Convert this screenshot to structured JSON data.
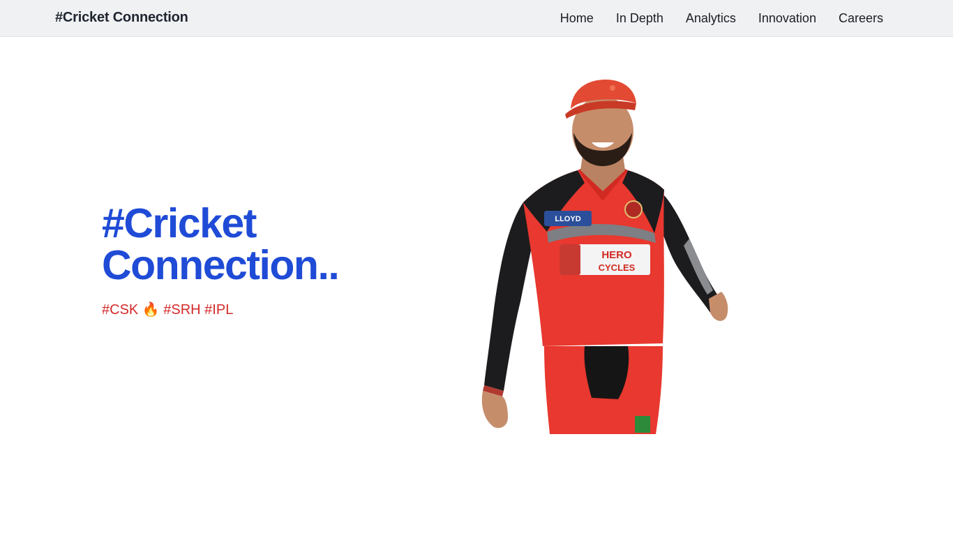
{
  "navbar": {
    "brand": "#Cricket Connection",
    "links": [
      {
        "label": "Home"
      },
      {
        "label": "In Depth"
      },
      {
        "label": "Analytics"
      },
      {
        "label": "Innovation"
      },
      {
        "label": "Careers"
      }
    ]
  },
  "hero": {
    "title_line1": "#Cricket",
    "title_line2": "Connection..",
    "tags": "#CSK 🔥 #SRH #IPL"
  },
  "player_image": {
    "cap_text": "",
    "sponsor_chest": "HERO CYCLES",
    "sponsor_top": "LLOYD"
  },
  "colors": {
    "accent_blue": "#1f4bd6",
    "tag_red": "#d42a2a",
    "navbar_bg": "#f0f1f3",
    "jersey_red": "#e8382f",
    "jersey_black": "#1c1c1e"
  }
}
